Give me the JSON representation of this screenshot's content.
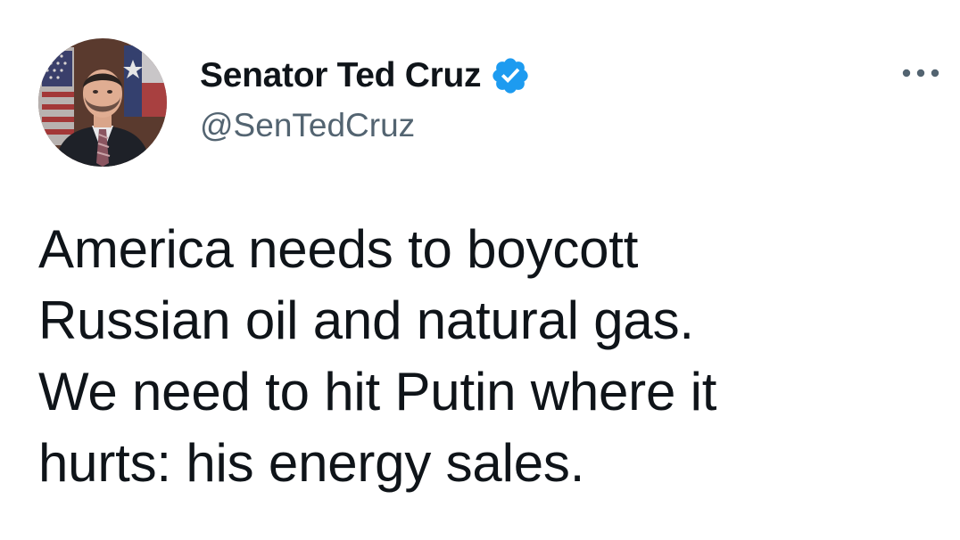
{
  "author": {
    "display_name": "Senator Ted Cruz",
    "handle": "@SenTedCruz",
    "verified": true,
    "verified_color": "#1d9bf0",
    "avatar": "profile-photo"
  },
  "tweet": {
    "lines": [
      "America needs to boycott",
      "Russian oil and natural gas.",
      "We need to hit Putin where it",
      "hurts: his energy sales."
    ]
  },
  "icons": {
    "more": "more-horizontal-icon",
    "verified": "verified-badge-icon"
  },
  "colors": {
    "text": "#0f1419",
    "secondary": "#536471",
    "accent": "#1d9bf0"
  }
}
